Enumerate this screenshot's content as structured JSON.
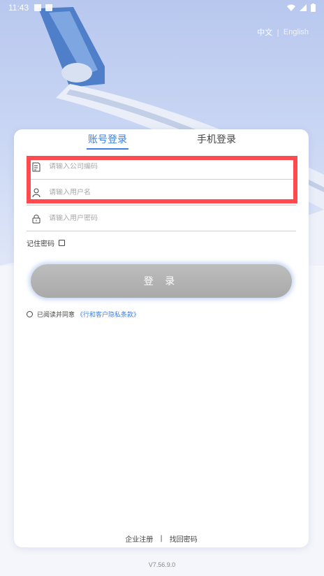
{
  "status_bar": {
    "time": "11:43"
  },
  "language": {
    "chinese": "中文",
    "separator": "|",
    "english": "English"
  },
  "tabs": {
    "account_login": "账号登录",
    "phone_login": "手机登录"
  },
  "form": {
    "company_code_placeholder": "请输入公司编码",
    "username_placeholder": "请输入用户名",
    "password_placeholder": "请输入用户密码",
    "remember_password": "记住密码",
    "login_button": "登 录"
  },
  "agreement": {
    "text": "已阅读并同意",
    "link": "《行和客户隐私条款》"
  },
  "footer": {
    "enterprise_register": "企业注册",
    "separator": "|",
    "find_password": "找回密码",
    "version": "V7.56.9.0"
  },
  "colors": {
    "accent": "#3d7fe3",
    "highlight": "#ff4a4f",
    "button": "#b3b3b3"
  },
  "icons": [
    "wifi-icon",
    "battery-icon",
    "document-icon",
    "user-icon",
    "lock-icon"
  ]
}
